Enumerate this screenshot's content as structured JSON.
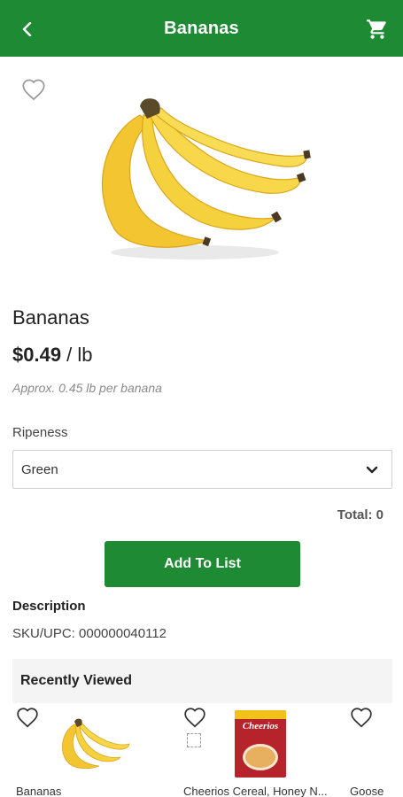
{
  "header": {
    "title": "Bananas",
    "back_icon": "chevron-left-icon",
    "cart_icon": "cart-icon",
    "color": "#1f8a34"
  },
  "product": {
    "name": "Bananas",
    "price": "$0.49",
    "unit": " / lb",
    "approx": "Approx. 0.45 lb per banana",
    "favorite_icon": "heart-outline-icon"
  },
  "ripeness": {
    "label": "Ripeness",
    "selected": "Green"
  },
  "total": {
    "label": "Total: 0"
  },
  "add_button": {
    "label": "Add To List"
  },
  "description": {
    "heading": "Description",
    "sku": "SKU/UPC: 000000040112"
  },
  "recently_viewed": {
    "heading": "Recently Viewed",
    "items": [
      {
        "label": "Bananas"
      },
      {
        "label": "Cheerios Cereal, Honey N..."
      },
      {
        "label": "Goose"
      }
    ],
    "cereal_box_text": "Cheerios"
  }
}
